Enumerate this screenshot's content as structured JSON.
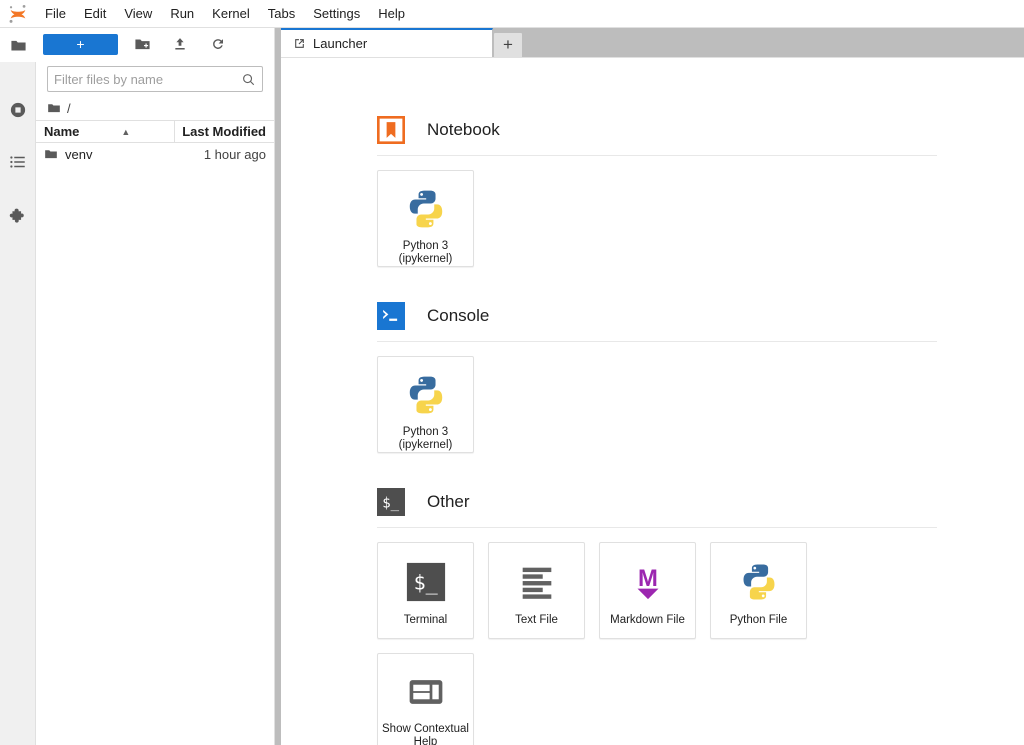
{
  "menubar": {
    "logo": "jupyter-logo",
    "items": [
      {
        "label": "File"
      },
      {
        "label": "Edit"
      },
      {
        "label": "View"
      },
      {
        "label": "Run"
      },
      {
        "label": "Kernel"
      },
      {
        "label": "Tabs"
      },
      {
        "label": "Settings"
      },
      {
        "label": "Help"
      }
    ]
  },
  "activitybar": {
    "items": [
      {
        "name": "file-browser",
        "icon": "folder-icon",
        "active": true
      },
      {
        "name": "running-sessions",
        "icon": "stop-circle-icon",
        "active": false
      },
      {
        "name": "command-palette",
        "icon": "list-icon",
        "active": false
      },
      {
        "name": "extension-manager",
        "icon": "puzzle-icon",
        "active": false
      }
    ]
  },
  "filebrowser": {
    "toolbar": {
      "new_label": "+",
      "new_folder_icon": "new-folder-icon",
      "upload_icon": "upload-icon",
      "refresh_icon": "refresh-icon"
    },
    "filter": {
      "placeholder": "Filter files by name",
      "value": "",
      "icon": "search-icon"
    },
    "breadcrumb": {
      "icon": "folder-icon",
      "path": "/"
    },
    "columns": {
      "name": "Name",
      "last_modified": "Last Modified",
      "sort_indicator": "▲"
    },
    "rows": [
      {
        "icon": "folder-icon",
        "name": "venv",
        "last_modified": "1 hour ago"
      }
    ]
  },
  "tabbar": {
    "tabs": [
      {
        "label": "Launcher",
        "icon": "launcher-icon",
        "active": true
      }
    ],
    "add_tab_label": "+"
  },
  "launcher": {
    "sections": [
      {
        "id": "notebook",
        "title": "Notebook",
        "icon": "notebook-icon",
        "cards": [
          {
            "label": "Python 3\n(ipykernel)",
            "line1": "Python 3",
            "line2": "(ipykernel)",
            "icon": "python-icon"
          }
        ]
      },
      {
        "id": "console",
        "title": "Console",
        "icon": "console-icon",
        "cards": [
          {
            "label": "Python 3\n(ipykernel)",
            "line1": "Python 3",
            "line2": "(ipykernel)",
            "icon": "python-icon"
          }
        ]
      },
      {
        "id": "other",
        "title": "Other",
        "icon": "terminal-icon",
        "cards": [
          {
            "label": "Terminal",
            "line1": "Terminal",
            "line2": "",
            "icon": "terminal-icon"
          },
          {
            "label": "Text File",
            "line1": "Text File",
            "line2": "",
            "icon": "text-file-icon"
          },
          {
            "label": "Markdown File",
            "line1": "Markdown File",
            "line2": "",
            "icon": "markdown-icon"
          },
          {
            "label": "Python File",
            "line1": "Python File",
            "line2": "",
            "icon": "python-icon"
          },
          {
            "label": "Show Contextual Help",
            "line1": "Show Contextual",
            "line2": "Help",
            "icon": "contextual-help-icon"
          }
        ]
      }
    ]
  },
  "colors": {
    "accent_blue": "#1976d2",
    "notebook_orange": "#ef6c20",
    "markdown_purple": "#9c27b0",
    "python_blue": "#386c9f",
    "python_yellow": "#f7d44c",
    "terminal_dark": "#4e4e4e",
    "tabbar_gray": "#bdbdbd"
  }
}
